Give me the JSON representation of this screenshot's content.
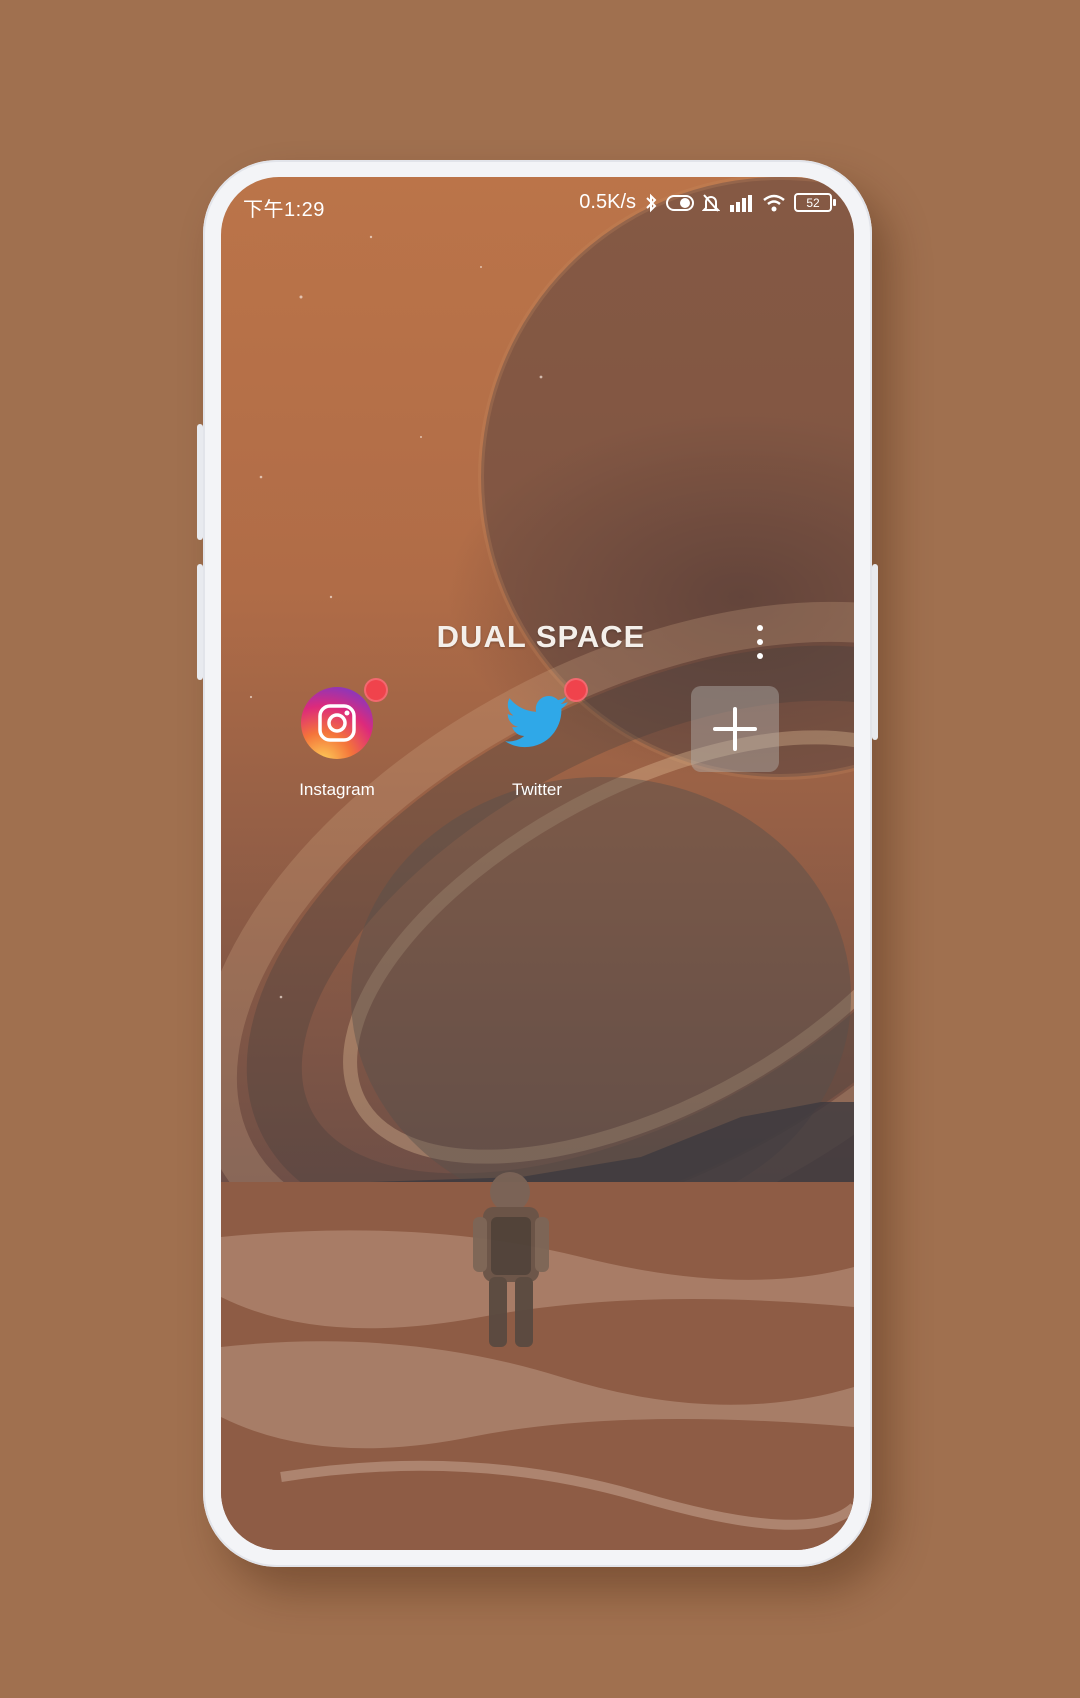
{
  "status_bar": {
    "time": "下午1:29",
    "speed": "0.5K/s",
    "battery": "52",
    "icons": [
      "bluetooth-icon",
      "toggle-icon",
      "alarm-off-icon",
      "signal-icon",
      "wifi-icon",
      "battery-icon"
    ]
  },
  "header": {
    "logo_text": "DUAL SPACE"
  },
  "apps": [
    {
      "label": "Instagram",
      "icon": "instagram-icon",
      "badge": "hot-badge-icon"
    },
    {
      "label": "Twitter",
      "icon": "twitter-icon",
      "badge": "hot-badge-icon"
    }
  ],
  "add_button_icon": "plus-icon",
  "menu_icon": "more-vert-icon",
  "colors": {
    "background": "#a0704f",
    "phone_frame": "#f3f4f7",
    "badge": "#f0434c",
    "twitter": "#2fa8e8"
  }
}
